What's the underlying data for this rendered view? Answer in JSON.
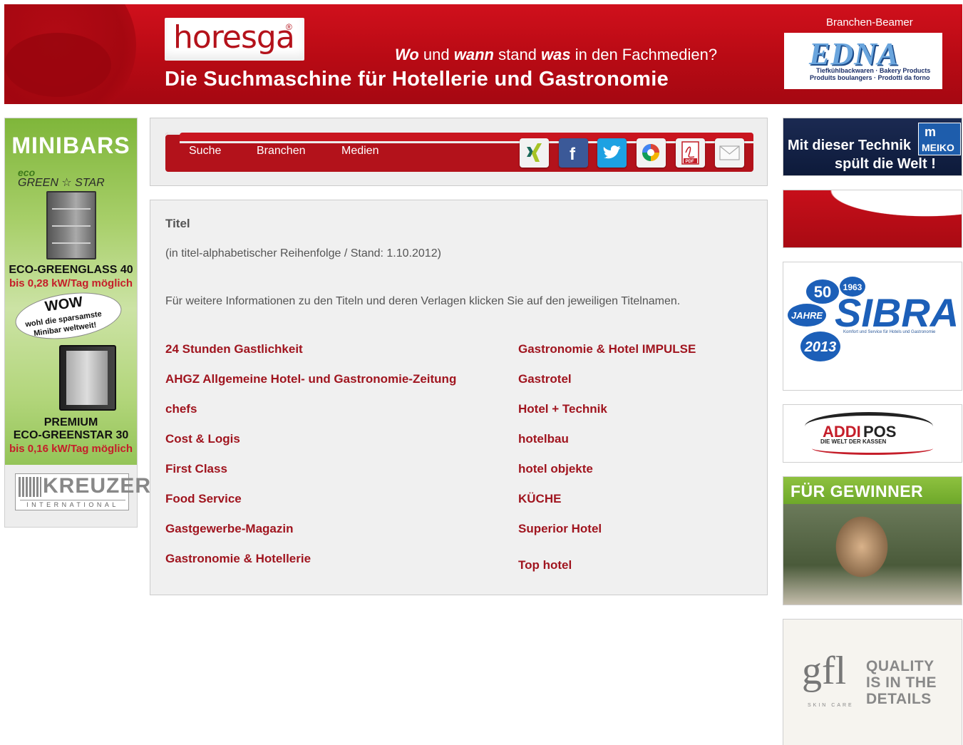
{
  "header": {
    "logo": "horesga",
    "tagline": {
      "part1_bold": "Wo",
      "part2": " und ",
      "part3_bold": "wann",
      "part4": " stand ",
      "part5_bold": "was",
      "part6": " in den Fachmedien?"
    },
    "headline": "Die Suchmaschine für Hotellerie und Gastronomie",
    "beamer_label": "Branchen-Beamer",
    "beamer_ad": {
      "name": "EDNA",
      "line1": "Tiefkühlbackwaren · Bakery Products",
      "line2": "Produits boulangers · Prodotti da forno"
    }
  },
  "left_ad": {
    "title": "MINIBARS",
    "brand_eco": "eco",
    "brand_star": "GREEN ☆ STAR",
    "product1": "ECO-GREENGLASS 40",
    "product1_note": "bis 0,28 kW/Tag möglich",
    "wow": "WOW",
    "wow_sub1": "wohl die sparsamste",
    "wow_sub2": "Minibar weltweit!",
    "product2_line1": "PREMIUM",
    "product2_line2": "ECO-GREENSTAR 30",
    "product2_note": "bis 0,16 kW/Tag möglich",
    "company": "KREUZER",
    "company_sub": "INTERNATIONAL"
  },
  "nav": {
    "items": [
      "Suche",
      "Branchen",
      "Medien"
    ],
    "share": [
      "xing-icon",
      "facebook-icon",
      "twitter-icon",
      "google-buzz-icon",
      "pdf-icon",
      "mail-icon"
    ],
    "pdf_label": "PDF"
  },
  "content": {
    "title": "Titel",
    "subtitle": "(in titel-alphabetischer Reihenfolge / Stand: 1.10.2012)",
    "info": "Für weitere Informationen zu den Titeln und deren Verlagen klicken Sie auf den jeweiligen Titelnamen.",
    "left_titles": [
      "24 Stunden Gastlichkeit",
      "AHGZ Allgemeine Hotel- und Gastronomie-Zeitung",
      "chefs",
      "Cost & Logis",
      "First Class",
      "Food Service",
      "Gastgewerbe-Magazin",
      "Gastronomie & Hotellerie"
    ],
    "right_titles": [
      "Gastronomie & Hotel IMPULSE",
      "Gastrotel",
      "Hotel + Technik",
      "hotelbau",
      "hotel objekte",
      "KÜCHE",
      "Superior Hotel",
      "Top hotel"
    ]
  },
  "right_ads": {
    "meiko": {
      "line1": "Mit dieser Technik",
      "line2": "spült die Welt !",
      "logo": "MEIKO"
    },
    "sibra": {
      "name": "SIBRA",
      "fifty": "50",
      "year1": "1963",
      "jahre": "JAHRE",
      "year2": "2013",
      "tag": "Komfort und Service für Hotels und Gastronomie"
    },
    "addipos": {
      "addi": "ADDI",
      "pos": "POS",
      "slogan": "DIE WELT DER KASSEN"
    },
    "gewinner": {
      "title": "FÜR GEWINNER"
    },
    "gfl": {
      "logo": "gfl",
      "skin": "SKIN CARE",
      "q1": "QUALITY",
      "q2": "IS IN THE",
      "q3": "DETAILS"
    }
  }
}
